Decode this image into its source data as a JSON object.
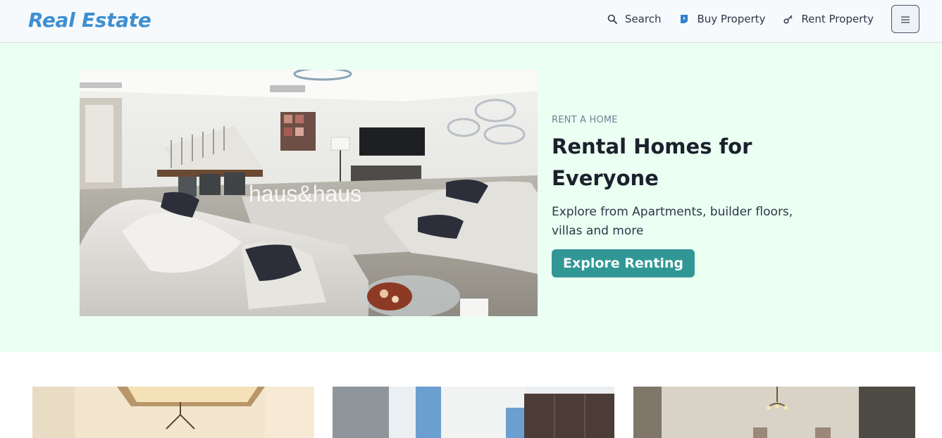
{
  "header": {
    "logo": "Real Estate",
    "nav": [
      {
        "label": "Search",
        "icon": "search-icon"
      },
      {
        "label": "Buy Property",
        "icon": "tag-icon"
      },
      {
        "label": "Rent Property",
        "icon": "key-icon"
      }
    ],
    "menu_icon": "hamburger-icon"
  },
  "hero": {
    "eyebrow": "RENT A HOME",
    "title": "Rental Homes for Everyone",
    "description": "Explore from Apartments, builder floors, villas and more",
    "cta_label": "Explore Renting",
    "image_watermark": "haus&haus"
  },
  "colors": {
    "brand": "#3f8fd2",
    "hero_background": "#ebfff2",
    "cta": "#319795"
  },
  "listings": [
    {
      "image": "property-photo-living-room"
    },
    {
      "image": "property-photo-bedroom"
    },
    {
      "image": "property-photo-room"
    }
  ]
}
